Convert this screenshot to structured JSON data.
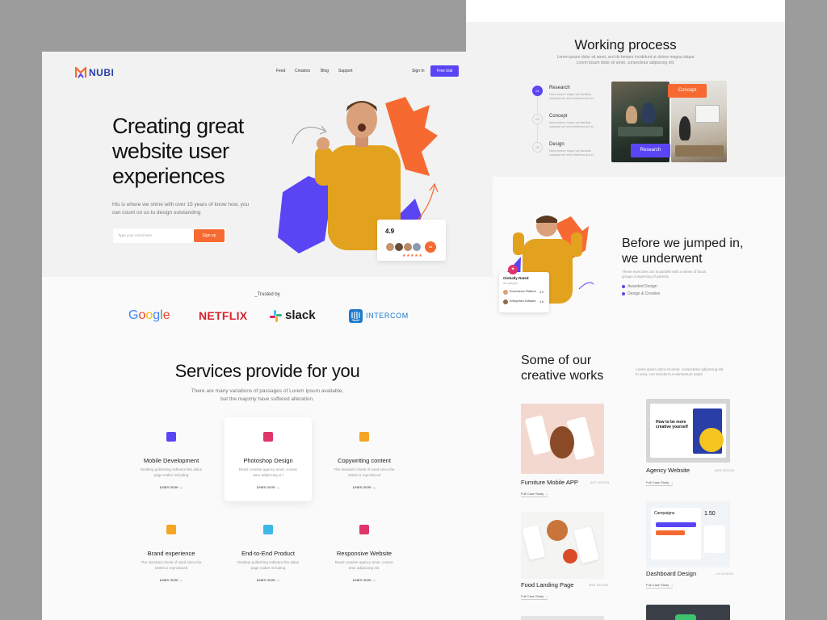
{
  "right": {
    "working": {
      "title": "Working process",
      "sub1": "Lorem ipsum dolor sit amet, sed do tempor incididunt ut dolore magna aliqua",
      "sub2": "Lorem ipsum dolor sit amet, consectetur adipiscing elit.",
      "steps": [
        {
          "num": "01",
          "title": "Research",
          "desc": "Nonummen sequi vel facilisis volutpat vel sem eleifend dui id"
        },
        {
          "num": "02",
          "title": "Concept",
          "desc": "Nonummen sequi vel facilisis volutpat vel sem eleifend dui id"
        },
        {
          "num": "03",
          "title": "Design",
          "desc": "Nonummen sequi vel facilisis volutpat vel sem eleifend dui id"
        }
      ],
      "badge_concept": "Concept",
      "badge_research": "Research"
    },
    "before": {
      "title_line1": "Before we jumped in,",
      "title_line2": "we underwent",
      "desc": "These exercises ran in parallel with a series of focus groups comprising of parents",
      "items": [
        "Awarded Design",
        "Design & Creative"
      ],
      "card_title": "Globally Rated",
      "card_sub": "All category",
      "card_rows": [
        {
          "name": "Ecommerce Platform",
          "meta": "Design Agency",
          "val": "4.9"
        },
        {
          "name": "Enterprises Software",
          "meta": "Creative Agency",
          "val": "4.8"
        }
      ]
    },
    "works": {
      "title_line1": "Some of our",
      "title_line2": "creative works",
      "desc": "Lorem ipsum dolor sit amet, consectetur adipiscing elit. In urna, non tincidunt ut elementum turpis",
      "projects": [
        {
          "name": "Furniture Mobile APP",
          "tag": "APP DESIGN",
          "link": "Full Case Study"
        },
        {
          "name": "Agency Website",
          "tag": "WEB DESIGN",
          "link": "Full Case Study"
        },
        {
          "name": "Food Landing Page",
          "tag": "WEB DESIGN",
          "link": "Full Case Study"
        },
        {
          "name": "Dashboard Design",
          "tag": "UX DESIGN",
          "link": "Full Case Study"
        }
      ],
      "agency_headline": "How to be more creative yourself",
      "dashboard_label": "Campaigns",
      "dashboard_value": "1.50"
    }
  },
  "left": {
    "logo": "NUBI",
    "nav": [
      "Feed",
      "Creators",
      "Blog",
      "Support"
    ],
    "sign_in": "Sign In",
    "free_trial": "Free trial",
    "hero": {
      "title": "Creating great website user experiences",
      "subtitle": "His is where we shine with over 15 years of know how, you can count on us to design outstanding",
      "email_placeholder": "Type your email here",
      "signup": "Sign up"
    },
    "rating": {
      "value": "4.9",
      "badge": "5k",
      "stars": "★★★★★"
    },
    "trusted": {
      "label": "_Trusted by",
      "brands": [
        "Google",
        "NETFLIX",
        "slack",
        "INTERCOM"
      ]
    },
    "services": {
      "title": "Services provide for you",
      "sub1": "There are many variations of passages of Lorem Ipsum available,",
      "sub2": "but the majority have suffered alteration.",
      "items": [
        {
          "title": "Mobile Development",
          "desc": "Desktop publishing software like aldus page maker including",
          "link": "Learn more"
        },
        {
          "title": "Photoshop Design",
          "desc": "React creative agency  amet, consec tetur adipiscing ol.l",
          "link": "Learn more"
        },
        {
          "title": "Copywriting content",
          "desc": "The standard chunk of used since the 1500s is reproduced",
          "link": "Learn more"
        },
        {
          "title": "Brand experience",
          "desc": "The standard chunk of used since the 1500s is reproduced",
          "link": "Learn more"
        },
        {
          "title": "End-to-End Product",
          "desc": "Desktop publishing software like aldus page maker including",
          "link": "Learn more"
        },
        {
          "title": "Responsive Website",
          "desc": "React creative agency  amet, consec tetur adipiscing elit.",
          "link": "Learn more"
        }
      ],
      "icon_colors": [
        "#5a45f5",
        "#e0356a",
        "#f5a524",
        "#f5a524",
        "#3cb8e6",
        "#e0356a"
      ]
    }
  }
}
